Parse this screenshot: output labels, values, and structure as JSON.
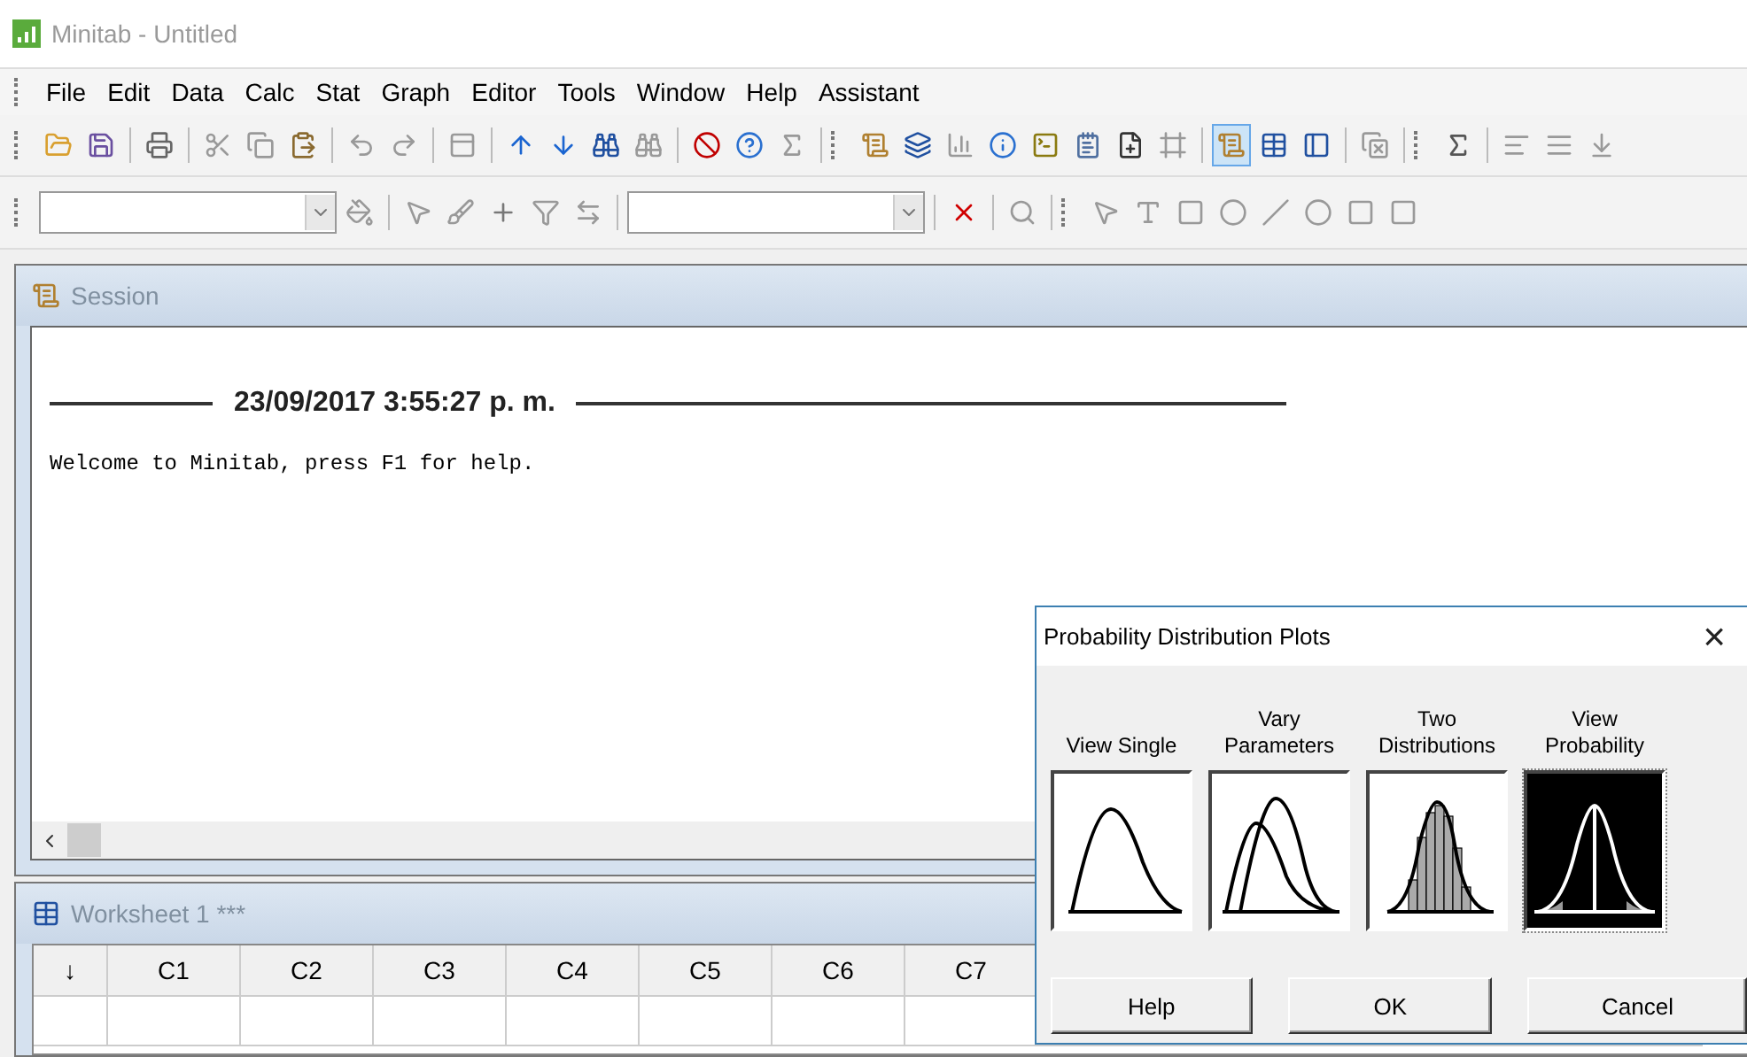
{
  "window": {
    "title": "Minitab - Untitled"
  },
  "menu": [
    {
      "label": "File"
    },
    {
      "label": "Edit"
    },
    {
      "label": "Data"
    },
    {
      "label": "Calc"
    },
    {
      "label": "Stat"
    },
    {
      "label": "Graph"
    },
    {
      "label": "Editor"
    },
    {
      "label": "Tools"
    },
    {
      "label": "Window"
    },
    {
      "label": "Help"
    },
    {
      "label": "Assistant"
    }
  ],
  "view_buttons": [
    {
      "selected": true
    },
    {
      "selected": false
    },
    {
      "selected": false
    }
  ],
  "session": {
    "title": "Session",
    "timestamp": "23/09/2017 3:55:27 p. m.",
    "message": "Welcome to Minitab, press F1 for help."
  },
  "worksheet": {
    "title": "Worksheet 1 ***",
    "columns": [
      "↓",
      "C1",
      "C2",
      "C3",
      "C4",
      "C5",
      "C6",
      "C7"
    ]
  },
  "dialog": {
    "title": "Probability Distribution Plots",
    "close": "×",
    "options": [
      {
        "kind": "single",
        "label": "View Single",
        "selected": false
      },
      {
        "kind": "vary",
        "label": "Vary Parameters",
        "selected": false
      },
      {
        "kind": "two",
        "label": "Two Distributions",
        "selected": false
      },
      {
        "kind": "probability",
        "label": "View Probability",
        "selected": true
      }
    ],
    "buttons": [
      {
        "label": "Help"
      },
      {
        "label": "OK"
      },
      {
        "label": "Cancel"
      }
    ]
  }
}
